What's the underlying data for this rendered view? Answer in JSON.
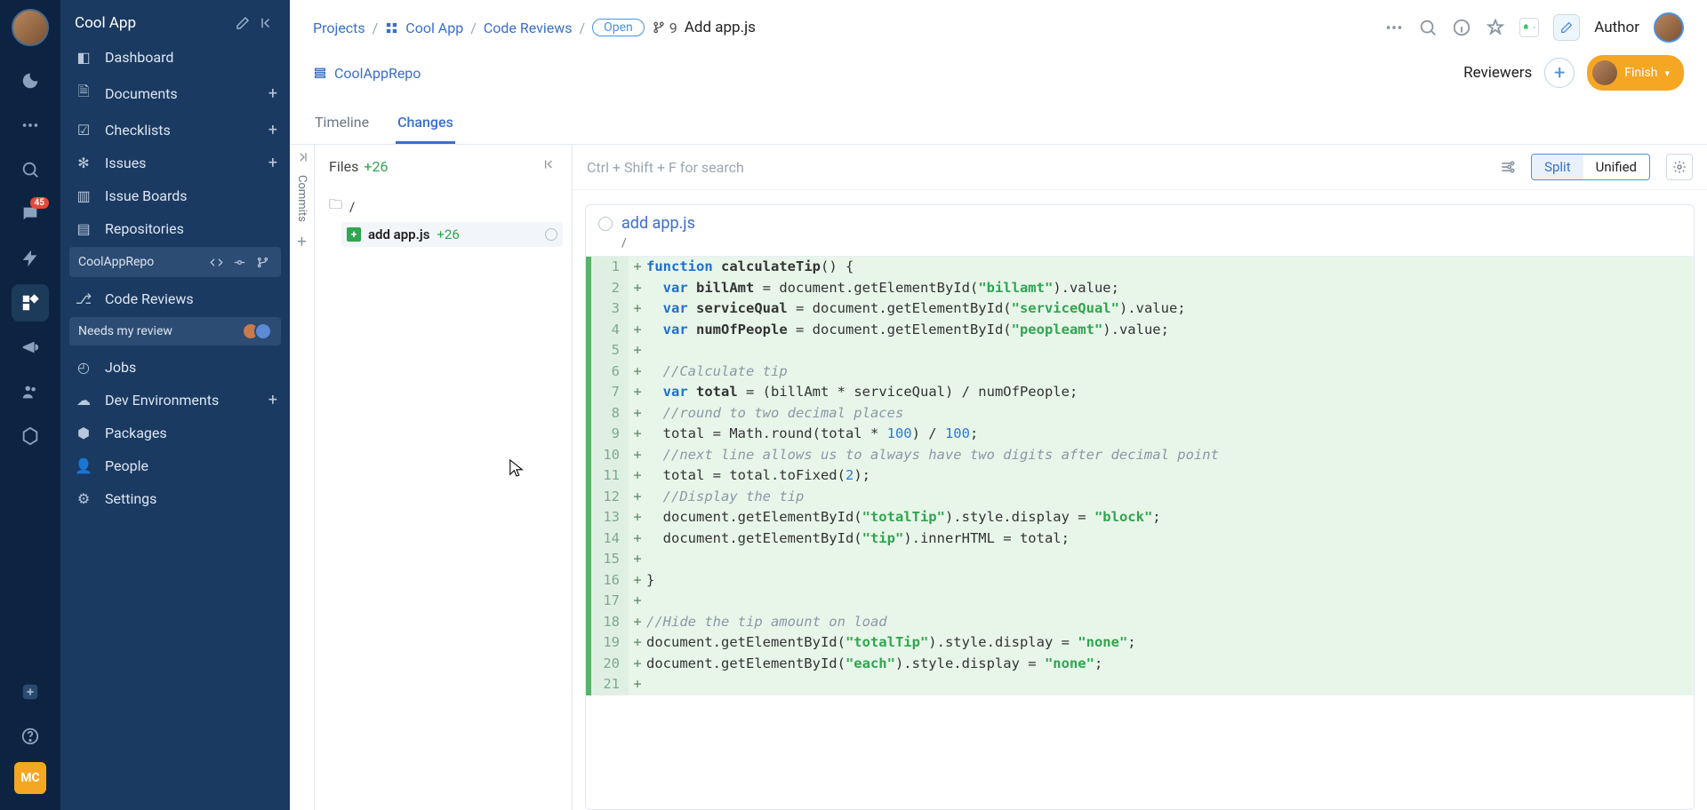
{
  "rail": {
    "chat_badge": "45",
    "mc": "MC"
  },
  "sidebar": {
    "title": "Cool App",
    "items": {
      "dashboard": "Dashboard",
      "documents": "Documents",
      "checklists": "Checklists",
      "issues": "Issues",
      "issue_boards": "Issue Boards",
      "repositories": "Repositories",
      "code_reviews": "Code Reviews",
      "jobs": "Jobs",
      "dev_envs": "Dev Environments",
      "packages": "Packages",
      "people": "People",
      "settings": "Settings"
    },
    "repo_sub": "CoolAppRepo",
    "review_sub": "Needs my review"
  },
  "breadcrumb": {
    "projects": "Projects",
    "project": "Cool App",
    "section": "Code Reviews",
    "status": "Open",
    "number": "9",
    "title": "Add app.js"
  },
  "header": {
    "author_label": "Author",
    "repo": "CoolAppRepo",
    "reviewers_label": "Reviewers",
    "finish": "Finish"
  },
  "tabs": {
    "timeline": "Timeline",
    "changes": "Changes"
  },
  "commits_label": "Commits",
  "files": {
    "label": "Files",
    "count": "+26",
    "root": "/",
    "file": "add app.js",
    "file_count": "+26"
  },
  "diff": {
    "search_placeholder": "Ctrl + Shift + F for search",
    "view_split": "Split",
    "view_unified": "Unified",
    "file_name": "add app.js",
    "file_path": "/"
  },
  "code": [
    {
      "n": 1,
      "html": "<span class=\"kw\">function</span> <span class=\"fn\">calculateTip</span>() {"
    },
    {
      "n": 2,
      "html": "  <span class=\"kw\">var</span> <span class=\"fn\">billAmt</span> = document.getElementById(<span class=\"str\">\"billamt\"</span>).value;"
    },
    {
      "n": 3,
      "html": "  <span class=\"kw\">var</span> <span class=\"fn\">serviceQual</span> = document.getElementById(<span class=\"str\">\"serviceQual\"</span>).value;"
    },
    {
      "n": 4,
      "html": "  <span class=\"kw\">var</span> <span class=\"fn\">numOfPeople</span> = document.getElementById(<span class=\"str\">\"peopleamt\"</span>).value;"
    },
    {
      "n": 5,
      "html": ""
    },
    {
      "n": 6,
      "html": "  <span class=\"cm\">//Calculate tip</span>"
    },
    {
      "n": 7,
      "html": "  <span class=\"kw\">var</span> <span class=\"fn\">total</span> = (billAmt * serviceQual) / numOfPeople;"
    },
    {
      "n": 8,
      "html": "  <span class=\"cm\">//round to two decimal places</span>"
    },
    {
      "n": 9,
      "html": "  total = Math.round(total * <span class=\"num\">100</span>) / <span class=\"num\">100</span>;"
    },
    {
      "n": 10,
      "html": "  <span class=\"cm\">//next line allows us to always have two digits after decimal point</span>"
    },
    {
      "n": 11,
      "html": "  total = total.toFixed(<span class=\"num\">2</span>);"
    },
    {
      "n": 12,
      "html": "  <span class=\"cm\">//Display the tip</span>"
    },
    {
      "n": 13,
      "html": "  document.getElementById(<span class=\"str\">\"totalTip\"</span>).style.display = <span class=\"str\">\"block\"</span>;"
    },
    {
      "n": 14,
      "html": "  document.getElementById(<span class=\"str\">\"tip\"</span>).innerHTML = total;"
    },
    {
      "n": 15,
      "html": ""
    },
    {
      "n": 16,
      "html": "}"
    },
    {
      "n": 17,
      "html": ""
    },
    {
      "n": 18,
      "html": "<span class=\"cm\">//Hide the tip amount on load</span>"
    },
    {
      "n": 19,
      "html": "document.getElementById(<span class=\"str\">\"totalTip\"</span>).style.display = <span class=\"str\">\"none\"</span>;"
    },
    {
      "n": 20,
      "html": "document.getElementById(<span class=\"str\">\"each\"</span>).style.display = <span class=\"str\">\"none\"</span>;"
    },
    {
      "n": 21,
      "html": ""
    }
  ]
}
